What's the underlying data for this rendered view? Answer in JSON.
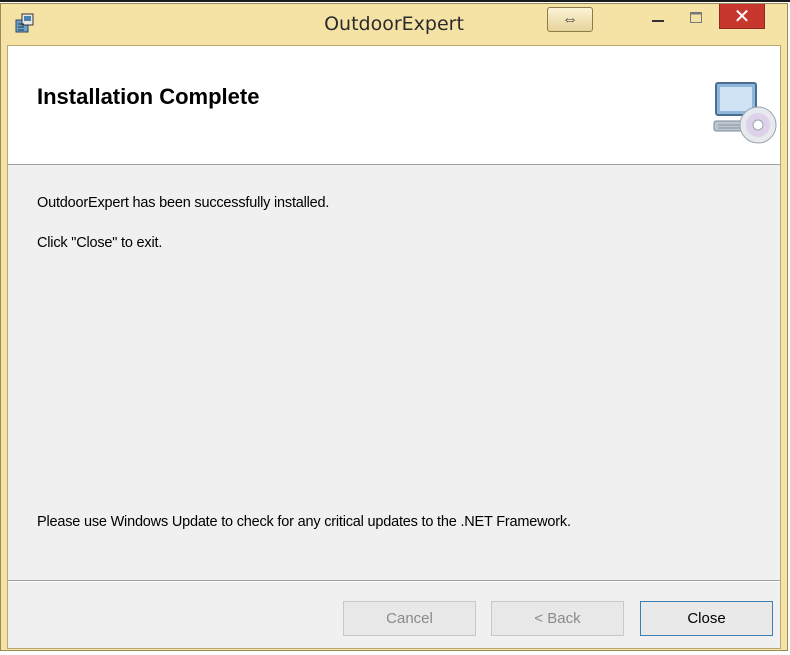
{
  "window": {
    "title": "OutdoorExpert",
    "snap_glyph": "⇔",
    "close_glyph": "✕"
  },
  "banner": {
    "title": "Installation Complete"
  },
  "body": {
    "line1": "OutdoorExpert has been successfully installed.",
    "line2": "Click \"Close\" to exit.",
    "line3": "Please use Windows Update to check for any critical updates to the .NET Framework."
  },
  "buttons": {
    "cancel": "Cancel",
    "back": "< Back",
    "close": "Close"
  },
  "colors": {
    "titlebar": "#f5e3a6",
    "close_button": "#c7372d",
    "client_bg": "#f0f0f0",
    "primary_border": "#3c7fb1"
  }
}
